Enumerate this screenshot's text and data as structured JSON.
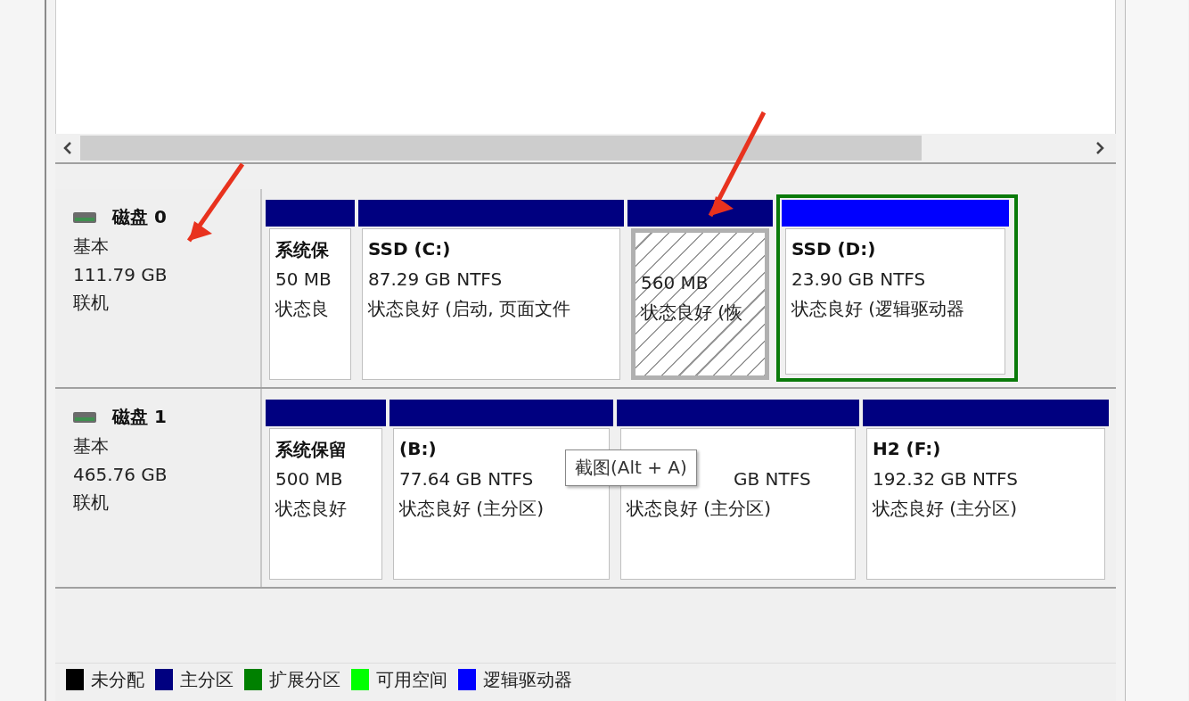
{
  "disks": [
    {
      "name": "磁盘 0",
      "type": "基本",
      "size": "111.79 GB",
      "status": "联机",
      "partitions": [
        {
          "kind": "primary",
          "selected": false,
          "name": "系统保",
          "size": "50 MB",
          "status": "状态良"
        },
        {
          "kind": "primary",
          "selected": false,
          "name": "SSD  (C:)",
          "size": "87.29 GB NTFS",
          "status": "状态良好 (启动, 页面文件"
        },
        {
          "kind": "primary",
          "selected": true,
          "size": "560 MB",
          "status": "状态良好 (恢"
        },
        {
          "kind": "logical",
          "selected": false,
          "name": "SSD  (D:)",
          "size": "23.90 GB NTFS",
          "status": "状态良好 (逻辑驱动器"
        }
      ]
    },
    {
      "name": "磁盘 1",
      "type": "基本",
      "size": "465.76 GB",
      "status": "联机",
      "partitions": [
        {
          "kind": "primary",
          "selected": false,
          "name": "系统保留",
          "size": "500 MB",
          "status": "状态良好"
        },
        {
          "kind": "primary",
          "selected": false,
          "name": "(B:)",
          "size": "77.64 GB NTFS",
          "status": "状态良好 (主分区)"
        },
        {
          "kind": "primary",
          "selected": false,
          "size": "GB NTFS",
          "status": "状态良好 (主分区)"
        },
        {
          "kind": "primary",
          "selected": false,
          "name": "H2  (F:)",
          "size": "192.32 GB NTFS",
          "status": "状态良好 (主分区)"
        }
      ]
    }
  ],
  "tooltip": "截图(Alt + A)",
  "legend": [
    {
      "label": "未分配",
      "color": "#000000"
    },
    {
      "label": "主分区",
      "color": "#000080"
    },
    {
      "label": "扩展分区",
      "color": "#008000"
    },
    {
      "label": "可用空间",
      "color": "#00ff00"
    },
    {
      "label": "逻辑驱动器",
      "color": "#0000ff"
    }
  ]
}
